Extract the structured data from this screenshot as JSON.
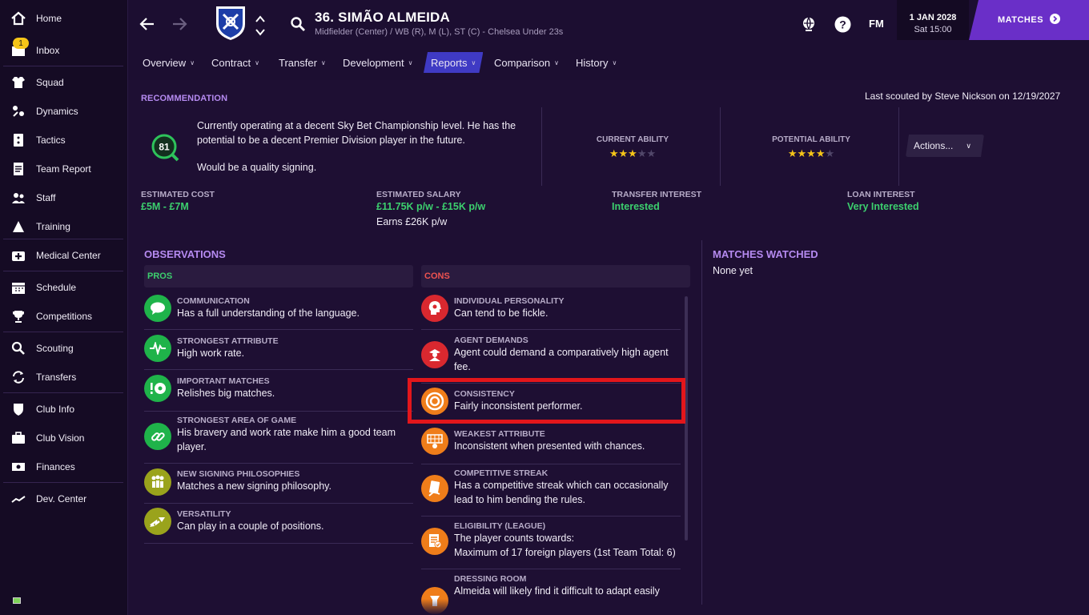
{
  "sidebar": {
    "items": [
      {
        "label": "Home",
        "icon": "home-icon"
      },
      {
        "label": "Inbox",
        "icon": "inbox-icon",
        "badge": "1"
      },
      {
        "label": "Squad",
        "icon": "shirt-icon"
      },
      {
        "label": "Dynamics",
        "icon": "dynamics-icon"
      },
      {
        "label": "Tactics",
        "icon": "tactics-icon"
      },
      {
        "label": "Team Report",
        "icon": "report-icon"
      },
      {
        "label": "Staff",
        "icon": "staff-icon"
      },
      {
        "label": "Training",
        "icon": "training-icon"
      },
      {
        "label": "Medical Center",
        "icon": "medical-icon"
      },
      {
        "label": "Schedule",
        "icon": "calendar-icon"
      },
      {
        "label": "Competitions",
        "icon": "trophy-icon"
      },
      {
        "label": "Scouting",
        "icon": "search-icon"
      },
      {
        "label": "Transfers",
        "icon": "transfer-icon"
      },
      {
        "label": "Club Info",
        "icon": "shield-icon"
      },
      {
        "label": "Club Vision",
        "icon": "briefcase-icon"
      },
      {
        "label": "Finances",
        "icon": "money-icon"
      },
      {
        "label": "Dev. Center",
        "icon": "trend-icon"
      }
    ]
  },
  "header": {
    "player_name": "36. SIMÃO ALMEIDA",
    "player_sub": "Midfielder (Center) / WB (R), M (L), ST (C) - Chelsea Under 23s",
    "fm_label": "FM",
    "date": "1 JAN 2028",
    "time": "Sat 15:00",
    "matches_label": "MATCHES",
    "tabs": [
      {
        "label": "Overview",
        "active": false
      },
      {
        "label": "Contract",
        "active": false
      },
      {
        "label": "Transfer",
        "active": false
      },
      {
        "label": "Development",
        "active": false
      },
      {
        "label": "Reports",
        "active": true
      },
      {
        "label": "Comparison",
        "active": false
      },
      {
        "label": "History",
        "active": false
      }
    ]
  },
  "recommendation": {
    "title": "RECOMMENDATION",
    "last_scouted": "Last scouted by Steve Nickson on 12/19/2027",
    "score": "81",
    "text1": "Currently operating at a decent Sky Bet Championship level. He has the potential to be a decent Premier Division player in the future.",
    "text2": "Would be a quality signing.",
    "current_ability_label": "CURRENT ABILITY",
    "current_ability_stars": 3,
    "potential_ability_label": "POTENTIAL ABILITY",
    "potential_ability_stars": 4,
    "stars_max": 5,
    "actions_label": "Actions..."
  },
  "stats": {
    "estimated_cost_label": "ESTIMATED COST",
    "estimated_cost": "£5M - £7M",
    "estimated_salary_label": "ESTIMATED SALARY",
    "estimated_salary": "£11.75K p/w - £15K p/w",
    "earns": "Earns £26K p/w",
    "transfer_interest_label": "TRANSFER INTEREST",
    "transfer_interest": "Interested",
    "loan_interest_label": "LOAN INTEREST",
    "loan_interest": "Very Interested"
  },
  "observations": {
    "title": "OBSERVATIONS",
    "pros_label": "PROS",
    "cons_label": "CONS",
    "pros": [
      {
        "category": "COMMUNICATION",
        "desc": "Has a full understanding of the language.",
        "icon": "speech-bubble-icon",
        "color": "#1fb34a"
      },
      {
        "category": "STRONGEST ATTRIBUTE",
        "desc": "High work rate.",
        "icon": "pulse-icon",
        "color": "#1fb34a"
      },
      {
        "category": "IMPORTANT MATCHES",
        "desc": "Relishes big matches.",
        "icon": "football-alert-icon",
        "color": "#1fb34a"
      },
      {
        "category": "STRONGEST AREA OF GAME",
        "desc": "His bravery and work rate make him a good team player.",
        "icon": "link-icon",
        "color": "#1fb34a"
      },
      {
        "category": "NEW SIGNING PHILOSOPHIES",
        "desc": "Matches a new signing philosophy.",
        "icon": "people-icon",
        "color": "#9aa31c"
      },
      {
        "category": "VERSATILITY",
        "desc": "Can play in a couple of positions.",
        "icon": "arrows-icon",
        "color": "#9aa31c"
      }
    ],
    "cons": [
      {
        "category": "INDIVIDUAL PERSONALITY",
        "desc": "Can tend to be fickle.",
        "icon": "head-icon",
        "color": "#d9282f"
      },
      {
        "category": "AGENT DEMANDS",
        "desc": "Agent could demand a comparatively high agent fee.",
        "icon": "agent-icon",
        "color": "#d9282f"
      },
      {
        "category": "CONSISTENCY",
        "desc": "Fairly inconsistent performer.",
        "icon": "target-icon",
        "color": "#ef7d1a"
      },
      {
        "category": "WEAKEST ATTRIBUTE",
        "desc": "Inconsistent when presented with chances.",
        "icon": "goal-icon",
        "color": "#ef7d1a"
      },
      {
        "category": "COMPETITIVE STREAK",
        "desc": "Has a competitive streak which can occasionally lead to him bending the rules.",
        "icon": "card-icon",
        "color": "#ef7d1a"
      },
      {
        "category": "ELIGIBILITY (LEAGUE)",
        "desc": "The player counts towards:",
        "desc2": "Maximum of 17 foreign players (1st Team Total: 6)",
        "icon": "checklist-icon",
        "color": "#ef7d1a"
      },
      {
        "category": "DRESSING ROOM",
        "desc": "Almeida will likely find it difficult to adapt easily",
        "icon": "locker-icon",
        "color": "#ef7d1a"
      }
    ]
  },
  "matches_watched": {
    "title": "MATCHES WATCHED",
    "value": "None yet"
  },
  "colors": {
    "accent_purple": "#b58af0",
    "pro_green": "#3ccf6e",
    "con_red": "#ef5350",
    "highlight_red": "#e3161b"
  }
}
